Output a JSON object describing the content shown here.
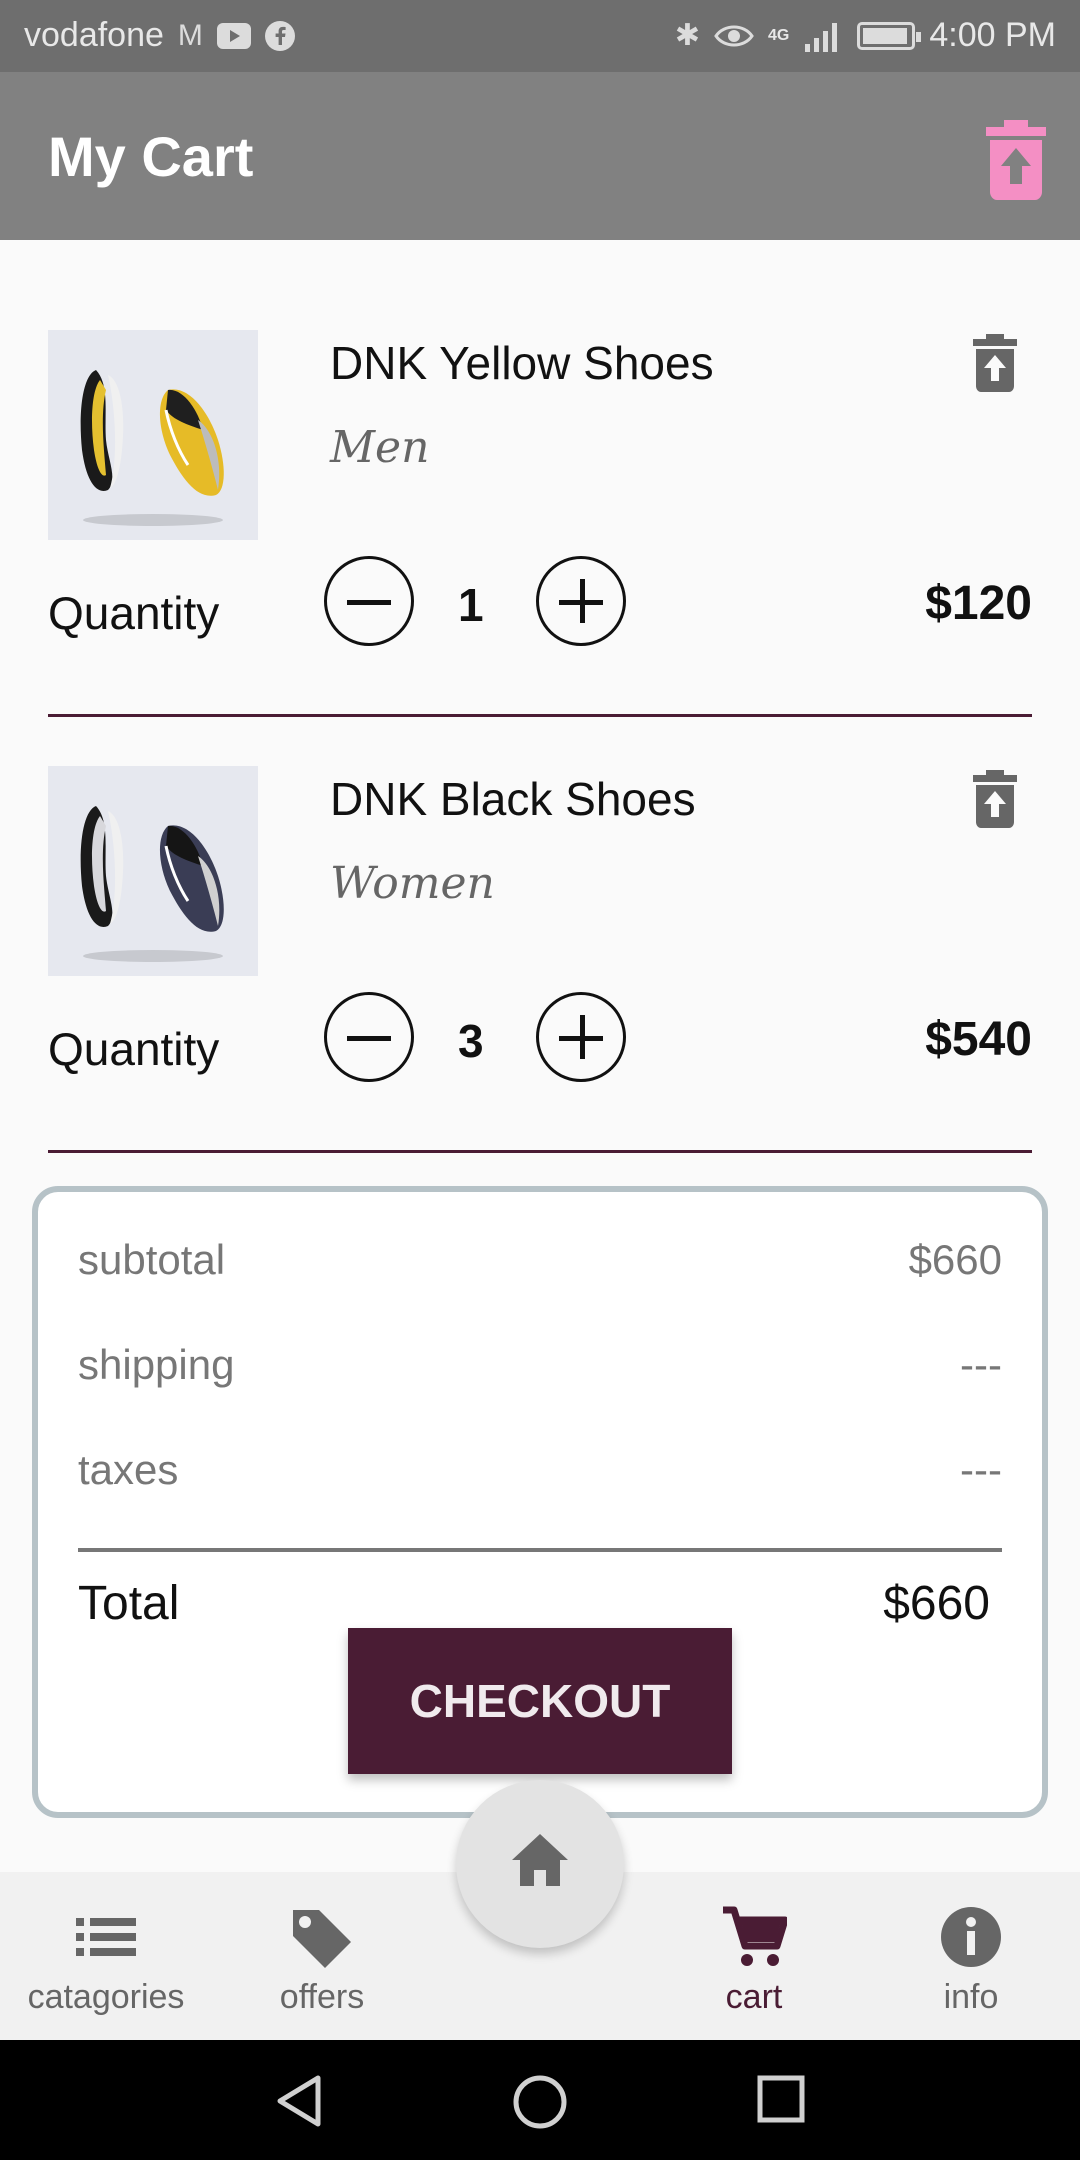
{
  "status_bar": {
    "carrier": "vodafone",
    "time": "4:00 PM",
    "network": "4G"
  },
  "app_bar": {
    "title": "My Cart"
  },
  "cart_items": [
    {
      "name": "DNK Yellow Shoes",
      "category": "Men",
      "quantity_label": "Quantity",
      "quantity": "1",
      "price": "$120"
    },
    {
      "name": "DNK Black Shoes",
      "category": "Women",
      "quantity_label": "Quantity",
      "quantity": "3",
      "price": "$540"
    }
  ],
  "summary": {
    "subtotal_label": "subtotal",
    "subtotal_value": "$660",
    "shipping_label": "shipping",
    "shipping_value": "---",
    "taxes_label": "taxes",
    "taxes_value": "---",
    "total_label": "Total",
    "total_value": "$660",
    "checkout_label": "CHECKOUT"
  },
  "bottom_nav": {
    "items": [
      {
        "label": "catagories",
        "icon": "list-icon"
      },
      {
        "label": "offers",
        "icon": "tag-icon"
      },
      {
        "label": "cart",
        "icon": "cart-icon"
      },
      {
        "label": "info",
        "icon": "info-icon"
      }
    ],
    "active": "cart",
    "home_icon": "home-icon"
  },
  "colors": {
    "accent": "#4a1c34",
    "app_bar": "#818181",
    "delete_all": "#f48fc4"
  }
}
